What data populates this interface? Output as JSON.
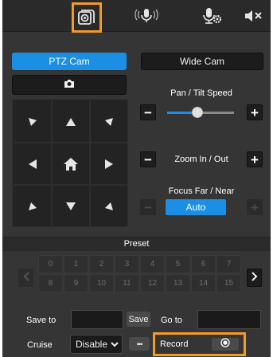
{
  "topbar": {
    "icons": [
      "camera-view-icon",
      "microphone-icon",
      "voice-settings-icon",
      "speaker-mute-icon"
    ],
    "active_highlight": "#f59b23"
  },
  "camera_tabs": [
    {
      "label": "PTZ Cam",
      "active": true
    },
    {
      "label": "Wide Cam",
      "active": false
    }
  ],
  "snapshot": {
    "icon": "camera-icon"
  },
  "dpad": {
    "icons": [
      "arrow-up-left-icon",
      "arrow-up-icon",
      "arrow-up-right-icon",
      "arrow-left-icon",
      "home-icon",
      "arrow-right-icon",
      "arrow-down-left-icon",
      "arrow-down-icon",
      "arrow-down-right-icon"
    ]
  },
  "pan_tilt": {
    "label": "Pan / Tilt Speed",
    "minus": "−",
    "plus": "+",
    "level": 0.45
  },
  "zoom": {
    "label": "Zoom In / Out",
    "minus": "−",
    "plus": "+"
  },
  "focus": {
    "label": "Focus Far / Near",
    "minus": "−",
    "plus": "+",
    "mode": "Auto"
  },
  "preset": {
    "title": "Preset",
    "numbers": [
      "0",
      "1",
      "2",
      "3",
      "4",
      "5",
      "6",
      "7",
      "8",
      "9",
      "10",
      "11",
      "12",
      "13",
      "14",
      "15"
    ]
  },
  "save": {
    "label": "Save to",
    "value": "",
    "button": "Save"
  },
  "goto": {
    "label": "Go to",
    "value": ""
  },
  "cruise": {
    "label": "Cruise",
    "selected": "Disable",
    "more": "•••"
  },
  "record": {
    "label": "Record"
  },
  "colors": {
    "accent_blue": "#1a8fe3",
    "highlight_orange": "#f59b23",
    "panel": "#353535"
  }
}
